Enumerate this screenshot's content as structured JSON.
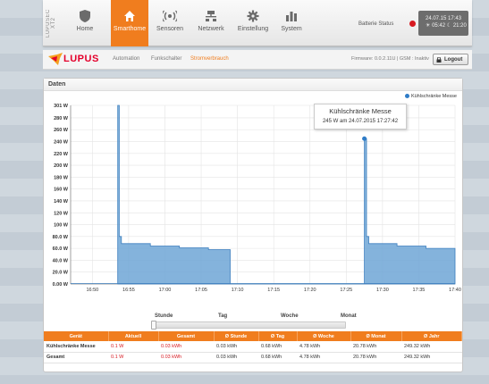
{
  "brand": {
    "vertical": "LUPUSEC XT2"
  },
  "nav": {
    "tabs": [
      {
        "label": "Home",
        "icon": "shield-icon"
      },
      {
        "label": "Smarthome",
        "icon": "house-icon"
      },
      {
        "label": "Sensoren",
        "icon": "sensor-icon"
      },
      {
        "label": "Netzwerk",
        "icon": "network-icon"
      },
      {
        "label": "Einstellung",
        "icon": "gear-icon"
      },
      {
        "label": "System",
        "icon": "bars-icon"
      }
    ],
    "active_index": 1
  },
  "status": {
    "label": "Batterie Status",
    "dot_color": "#d71920",
    "date": "24.07.15 17:43",
    "sun": "05:42",
    "moon": "21:20"
  },
  "subbar": {
    "logo": "LUPUS",
    "items": [
      "Automation",
      "Funkschalter",
      "Stromverbrauch"
    ],
    "active": "Stromverbrauch",
    "firmware": "Firmware: 0.0.2.11U | GSM : Inaktiv",
    "logout": "Logout"
  },
  "panel": {
    "title": "Daten"
  },
  "tooltip": {
    "title": "Kühlschränke Messe",
    "value": "245 W am 24.07.2015 17:27:42"
  },
  "range": {
    "labels": [
      "Stunde",
      "Tag",
      "Woche",
      "Monat"
    ]
  },
  "chart_data": {
    "type": "area",
    "series": [
      {
        "name": "Kühlschränke Messe",
        "color": "#5b9bd5"
      }
    ],
    "y_ticks": [
      "0.00 W",
      "20.0 W",
      "40.0 W",
      "60.0 W",
      "80.0 W",
      "100 W",
      "120 W",
      "140 W",
      "160 W",
      "180 W",
      "200 W",
      "220 W",
      "240 W",
      "260 W",
      "280 W",
      "301 W"
    ],
    "x_ticks": [
      "16:50",
      "16:55",
      "17:00",
      "17:05",
      "17:10",
      "17:15",
      "17:20",
      "17:25",
      "17:30",
      "17:35",
      "17:40"
    ],
    "ylim": [
      0,
      301
    ],
    "x_start_min": 1007,
    "x_end_min": 1060,
    "points": [
      [
        1013.5,
        0
      ],
      [
        1013.5,
        301
      ],
      [
        1013.7,
        301
      ],
      [
        1013.7,
        80
      ],
      [
        1014.0,
        80
      ],
      [
        1014.0,
        68
      ],
      [
        1018.0,
        68
      ],
      [
        1018.0,
        64
      ],
      [
        1022.0,
        64
      ],
      [
        1022.0,
        61
      ],
      [
        1026.0,
        61
      ],
      [
        1026.0,
        58
      ],
      [
        1029.0,
        58
      ],
      [
        1029.0,
        0
      ],
      [
        1047.5,
        0
      ],
      [
        1047.5,
        245
      ],
      [
        1047.8,
        245
      ],
      [
        1047.8,
        80
      ],
      [
        1048.1,
        80
      ],
      [
        1048.1,
        68
      ],
      [
        1052.0,
        68
      ],
      [
        1052.0,
        64
      ],
      [
        1056.0,
        64
      ],
      [
        1056.0,
        60
      ],
      [
        1060.0,
        60
      ],
      [
        1060.0,
        0
      ]
    ],
    "marker": {
      "x": 1047.5,
      "y": 245
    }
  },
  "table": {
    "headers": [
      "Gerät",
      "Aktuell",
      "Gesamt",
      "Ø Stunde",
      "Ø Tag",
      "Ø Woche",
      "Ø Monat",
      "Ø Jahr"
    ],
    "rows": [
      [
        "Kühlschränke Messe",
        "0.1 W",
        "0.03 kWh",
        "0.03 kWh",
        "0.68 kWh",
        "4.78 kWh",
        "20.78 kWh",
        "249.32 kWh"
      ],
      [
        "Gesamt",
        "0.1 W",
        "0.03 kWh",
        "0.03 kWh",
        "0.68 kWh",
        "4.78 kWh",
        "20.78 kWh",
        "249.32 kWh"
      ]
    ]
  }
}
